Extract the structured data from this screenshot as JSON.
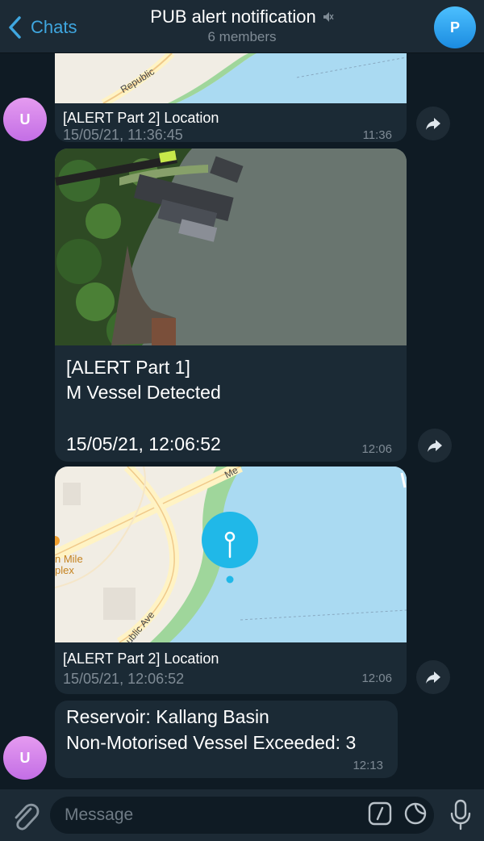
{
  "header": {
    "back_label": "Chats",
    "title": "PUB alert notification",
    "subtitle": "6 members",
    "avatar_letter": "P"
  },
  "messages": [
    {
      "type": "location",
      "sender_initial": "U",
      "title": "[ALERT Part 2] Location",
      "timestamp": "15/05/21, 11:36:45",
      "time": "11:36",
      "map_road_label": "Republic"
    },
    {
      "type": "photo",
      "line1": "[ALERT Part 1]",
      "line2": "M Vessel Detected",
      "timestamp": "15/05/21, 12:06:52",
      "time": "12:06"
    },
    {
      "type": "location",
      "title": "[ALERT Part 2] Location",
      "timestamp": "15/05/21, 12:06:52",
      "time": "12:06",
      "map_labels": [
        "n Mile",
        "plex",
        "ublic Ave",
        "Me"
      ]
    },
    {
      "type": "text",
      "sender_initial": "U",
      "line1": "Reservoir: Kallang Basin",
      "line2": "Non-Motorised Vessel Exceeded: 3",
      "time": "12:13"
    }
  ],
  "input": {
    "placeholder": "Message"
  },
  "colors": {
    "accent": "#3fa7e0",
    "background": "#0f1b24",
    "bubble": "#1b2a35",
    "water": "#aadaf2",
    "park": "#9fd69b",
    "pin": "#20b8e8"
  },
  "icons": {
    "back": "chevron-left-icon",
    "mute": "mute-icon",
    "forward": "share-arrow-icon",
    "attach": "paperclip-icon",
    "commands": "slash-command-icon",
    "sticker": "sticker-icon",
    "mic": "microphone-icon",
    "pin": "location-pin-icon"
  }
}
